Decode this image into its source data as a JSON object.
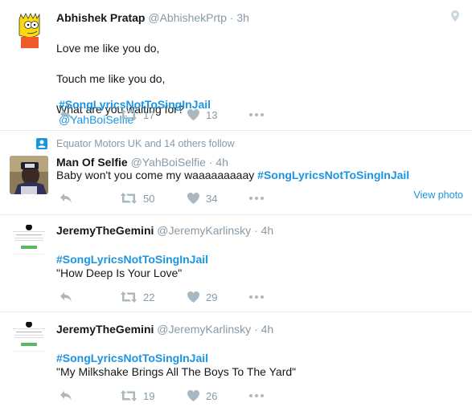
{
  "tweets": [
    {
      "name": "Abhishek Pratap",
      "handle": "@AbhishekPrtp",
      "time": "3h",
      "lines": [
        "Love me like you do,",
        "Touch me like you do,",
        "What are you waiting for?"
      ],
      "hashtag": "#SongLyricsNotToSingInJail",
      "mention": "@YahBoiSelfie",
      "retweets": "17",
      "likes": "13",
      "avatar": "bart-simpson-avatar"
    },
    {
      "context": "Equator Motors UK and 14 others follow",
      "name": "Man Of Selfie",
      "handle": "@YahBoiSelfie",
      "time": "4h",
      "text": "Baby won't you come my waaaaaaaaay",
      "hashtag": "#SongLyricsNotToSingInJail",
      "view_photo": "View photo",
      "retweets": "50",
      "likes": "34",
      "avatar": "selfie-avatar"
    },
    {
      "name": "JeremyTheGemini",
      "handle": "@JeremyKarlinsky",
      "time": "4h",
      "hashtag": "#SongLyricsNotToSingInJail",
      "text": "\"How Deep Is Your Love\"",
      "retweets": "22",
      "likes": "29",
      "avatar": "profile-screenshot-avatar"
    },
    {
      "name": "JeremyTheGemini",
      "handle": "@JeremyKarlinsky",
      "time": "4h",
      "hashtag": "#SongLyricsNotToSingInJail",
      "text": "\"My Milkshake Brings All The Boys To The Yard\"",
      "retweets": "19",
      "likes": "26",
      "avatar": "profile-screenshot-avatar"
    }
  ],
  "separator": "·",
  "icons": {
    "reply": "reply-icon",
    "retweet": "retweet-icon",
    "like": "heart-icon",
    "more": "more-icon",
    "geo": "location-pin-icon",
    "context": "follow-context-icon"
  },
  "colors": {
    "link": "#1b95e0",
    "muted": "#8899a6",
    "action": "#aab8c2"
  }
}
